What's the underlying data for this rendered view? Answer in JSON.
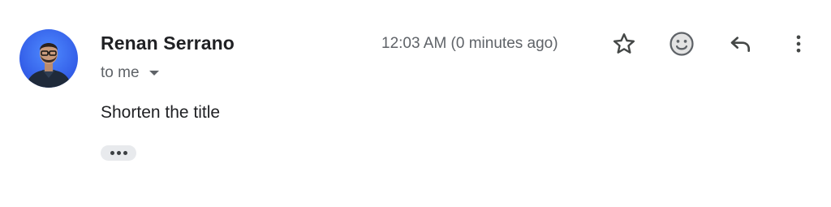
{
  "email": {
    "sender": {
      "name": "Renan Serrano",
      "avatar": "person-photo-avatar"
    },
    "recipient_label": "to me",
    "timestamp": "12:03 AM (0 minutes ago)",
    "body": "Shorten the title"
  },
  "actions": {
    "star_icon": "star-icon",
    "emoji_icon": "emoji-reaction-icon",
    "reply_icon": "reply-icon",
    "more_icon": "more-vertical-icon"
  },
  "colors": {
    "text_primary": "#202124",
    "text_secondary": "#5f6368",
    "icon": "#444746",
    "trimmed_bg": "#e8eaed",
    "avatar_bg": "#3366ff"
  }
}
